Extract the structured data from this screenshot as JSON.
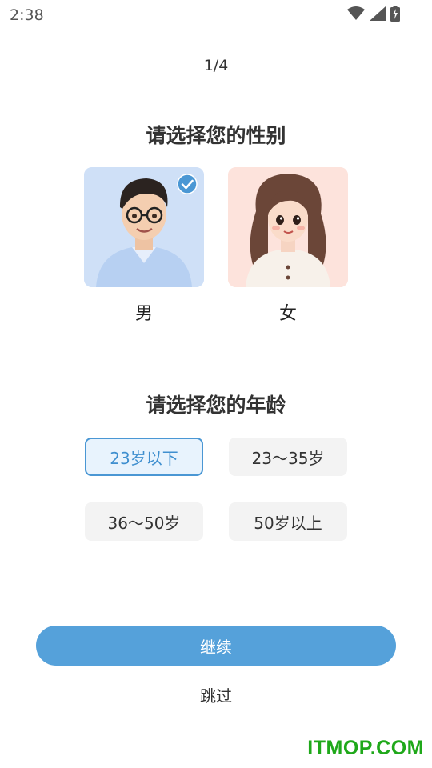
{
  "status_bar": {
    "time": "2:38",
    "icons": [
      "wifi-icon",
      "signal-icon",
      "battery-icon"
    ]
  },
  "progress": {
    "step": "1/4"
  },
  "gender": {
    "title": "请选择您的性别",
    "options": [
      {
        "label": "男",
        "selected": true,
        "background": "#cfe0f7"
      },
      {
        "label": "女",
        "selected": false,
        "background": "#fde3dc"
      }
    ]
  },
  "age": {
    "title": "请选择您的年龄",
    "options": [
      {
        "label": "23岁以下",
        "selected": true
      },
      {
        "label": "23～35岁",
        "selected": false
      },
      {
        "label": "36～50岁",
        "selected": false
      },
      {
        "label": "50岁以上",
        "selected": false
      }
    ]
  },
  "actions": {
    "continue_label": "继续",
    "skip_label": "跳过"
  },
  "watermark": "ITMOP.COM",
  "colors": {
    "accent": "#55a1da",
    "selected_border": "#4a97d4",
    "chip_bg": "#f3f3f3",
    "watermark": "#1fa81a"
  }
}
